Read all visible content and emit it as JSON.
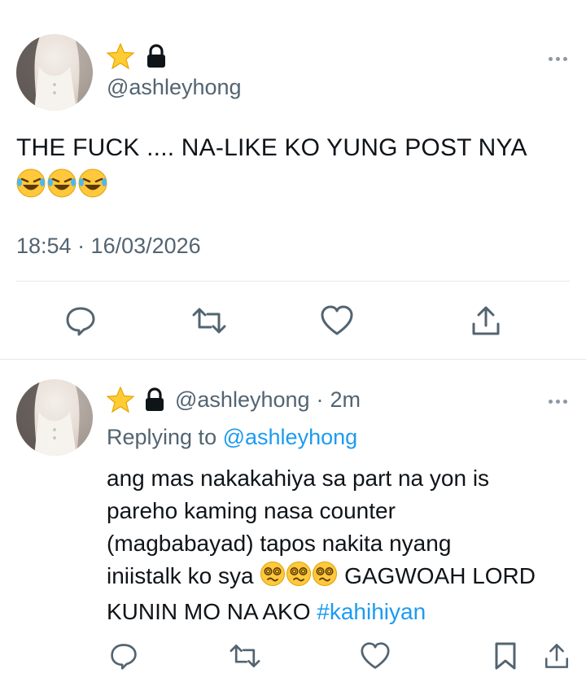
{
  "tweet": {
    "handle": "@ashleyhong",
    "text_line1": "THE FUCK .... NA-LIKE KO YUNG POST NYA",
    "timestamp": "18:54 · 16/03/2026",
    "icons": [
      "star-icon",
      "lock-icon",
      "more-icon",
      "laughing-emoji"
    ]
  },
  "actions": [
    "reply-icon",
    "retweet-icon",
    "like-icon",
    "share-icon"
  ],
  "reply": {
    "handle": "@ashleyhong",
    "separator": "·",
    "time": "2m",
    "replying_label": "Replying to",
    "replying_handle": "@ashleyhong",
    "text_line1": "ang mas nakakahiya sa part na yon is",
    "text_line2": "pareho kaming nasa counter",
    "text_line3": "(magbabayad) tapos nakita nyang",
    "text_line4_start": "iniistalk ko sya",
    "text_line4_end": "GAGWOAH LORD",
    "text_line5_start": "KUNIN MO NA AKO",
    "hashtag": "#kahihiyan",
    "actions": [
      "reply-icon",
      "retweet-icon",
      "like-icon",
      "bookmark-icon",
      "share-icon"
    ]
  },
  "colors": {
    "text": "#0f1419",
    "secondary": "#536471",
    "link": "#1d9bf0",
    "divider": "#e1e8ed"
  }
}
